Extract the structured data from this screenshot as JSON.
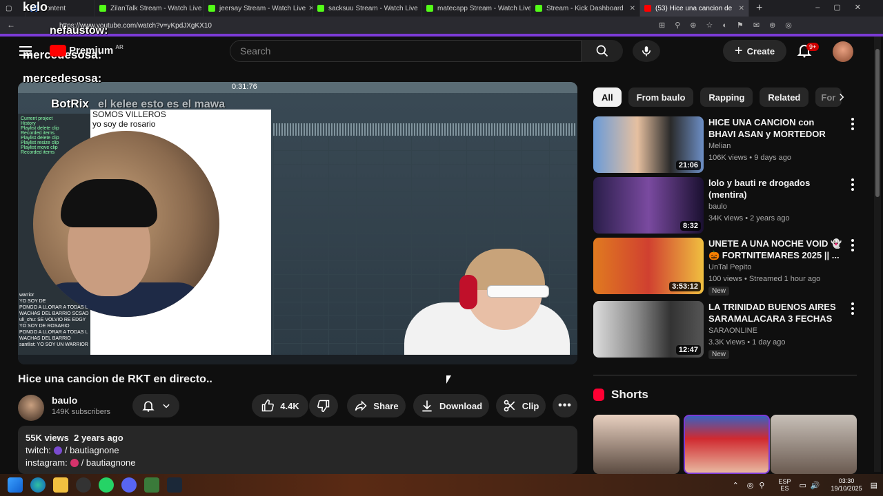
{
  "browser": {
    "tabs": [
      {
        "label": "Content",
        "active": false
      },
      {
        "label": "ZilanTalk Stream - Watch Live",
        "active": false
      },
      {
        "label": "jeersay Stream - Watch Live",
        "active": false
      },
      {
        "label": "sacksuu Stream - Watch Live",
        "active": false
      },
      {
        "label": "matecapp Stream - Watch Live",
        "active": false
      },
      {
        "label": "Stream - Kick Dashboard",
        "active": false
      },
      {
        "label": "(53) Hice una cancion de",
        "active": true
      }
    ],
    "url": "https://www.youtube.com/watch?v=yKpdJXgKX10"
  },
  "overlay": {
    "streamer_name": "kelo",
    "chat1_user": "nefaustow:",
    "chat2_user": "mercedesosa:",
    "chat3_user": "mercedesosa:",
    "chat4_user": "BotRix",
    "chat4_text": "el kelee esto es el mawa"
  },
  "header": {
    "logo_text": "Premium",
    "region": "AR",
    "search_placeholder": "Search",
    "create_label": "Create",
    "notif_count": "9+"
  },
  "player": {
    "timer": "0:31:76",
    "notes": [
      "SOMOS VILLEROS",
      "yo soy de rosario"
    ],
    "browser_title": "Current project",
    "browser_items": [
      "History",
      "Playlist delete clip",
      "Recorded items",
      "Playlist delete clip",
      "Playlist resize clip",
      "Playlist move clip",
      "Recorded items"
    ],
    "chat_lines": [
      "warrior",
      "YO SOY DE",
      "PONGO A LLORAR A TODAS L",
      "WACHAS DEL BARRIO SCSAD",
      "uli_chu: SE VOLVIO RE EDGY",
      "YO SOY DE ROSARIO",
      "PONGO A LLORAR A TODAS L",
      "WACHAS DEL BARRIO",
      "santlist: YO SOY UN WARRIOR"
    ]
  },
  "video": {
    "title": "Hice una cancion de RKT en directo..",
    "channel": "baulo",
    "subscribers": "149K subscribers",
    "likes": "4.4K",
    "share_label": "Share",
    "download_label": "Download",
    "clip_label": "Clip",
    "views": "55K views",
    "age": "2 years ago",
    "twitch_label": "twitch:",
    "twitch_handle": "/ bautiagnone",
    "instagram_label": "instagram:",
    "instagram_handle": "/ bautiagnone"
  },
  "chips": [
    "All",
    "From baulo",
    "Rapping",
    "Related",
    "For"
  ],
  "recommendations": [
    {
      "title": "HICE UNA CANCION con BHAVI ASAN y MORTEDOR",
      "channel": "Melian",
      "views": "106K views • 9 days ago",
      "duration": "21:06",
      "new": ""
    },
    {
      "title": "lolo y bauti re drogados (mentira)",
      "channel": "baulo",
      "views": "34K views • 2 years ago",
      "duration": "8:32",
      "new": ""
    },
    {
      "title": "UNETE A UNA NOCHE VOID 👻 🎃 FORTNITEMARES 2025 || ...",
      "channel": "UnTal Pepito",
      "views": "100 views • Streamed 1 hour ago",
      "duration": "3:53:12",
      "new": "New"
    },
    {
      "title": "LA TRINIDAD BUENOS AIRES SARAMALACARA 3 FECHAS",
      "channel": "SARAONLINE",
      "views": "3.3K views • 1 day ago",
      "duration": "12:47",
      "new": "New"
    }
  ],
  "shorts": {
    "title": "Shorts"
  },
  "taskbar": {
    "lang_top": "ESP",
    "lang_bottom": "ES",
    "time": "03:30",
    "date": "19/10/2025"
  },
  "colors": {
    "yt_red": "#ff0000",
    "kick_green": "#53fc18",
    "accent_purple": "#7c3bd6",
    "bg": "#0f0f0f"
  }
}
